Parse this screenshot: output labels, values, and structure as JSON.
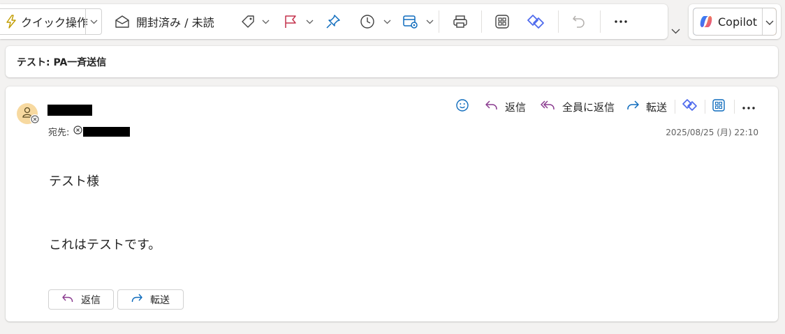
{
  "toolbar": {
    "quick_actions_label": "クイック操作",
    "read_unread_label": "開封済み / 未読",
    "more_label": "···"
  },
  "copilot": {
    "label": "Copilot"
  },
  "subject": "テスト: PA一斉送信",
  "message": {
    "to_label": "宛先:",
    "timestamp": "2025/08/25 (月) 22:10",
    "actions": {
      "reply": "返信",
      "reply_all": "全員に返信",
      "forward": "転送",
      "more": "···"
    },
    "body": [
      "テスト様",
      "これはテストです。"
    ],
    "footer": {
      "reply": "返信",
      "forward": "転送"
    }
  },
  "colors": {
    "reply_purple": "#8a3b8f",
    "forward_blue": "#0f6cbd",
    "flag_red": "#c4314b",
    "pin_blue": "#0f6cbd",
    "quick_yellow": "#c19c00"
  }
}
